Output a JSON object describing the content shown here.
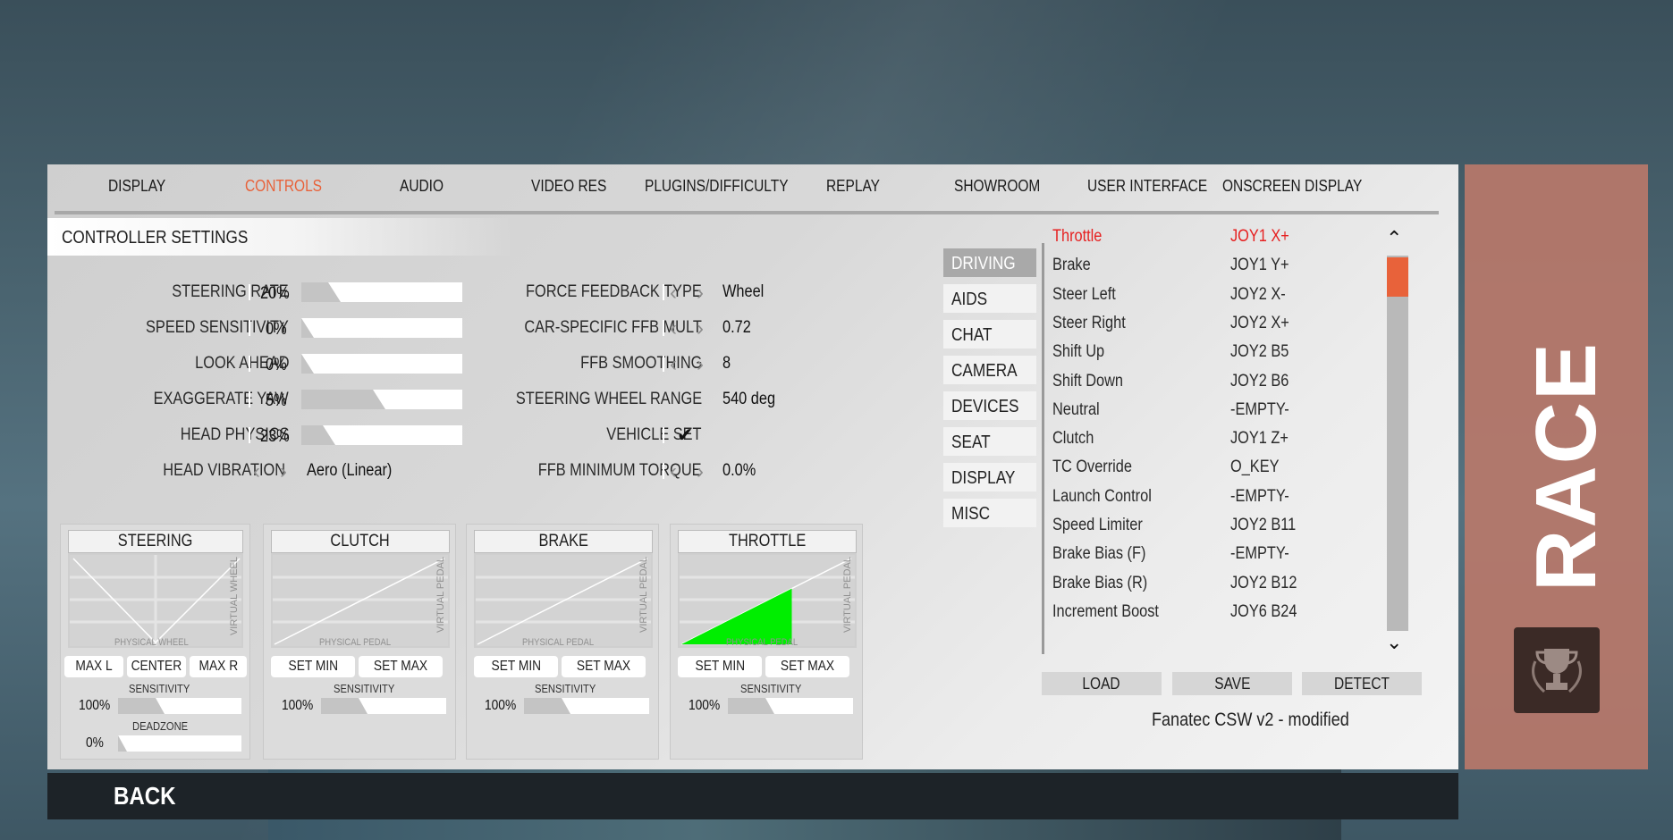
{
  "nav": {
    "tabs": [
      {
        "label": "DISPLAY"
      },
      {
        "label": "CONTROLS",
        "active": true
      },
      {
        "label": "AUDIO"
      },
      {
        "label": "VIDEO RES"
      },
      {
        "label": "PLUGINS/DIFFICULTY"
      },
      {
        "label": "REPLAY"
      },
      {
        "label": "SHOWROOM"
      },
      {
        "label": "USER INTERFACE"
      },
      {
        "label": "ONSCREEN DISPLAY"
      }
    ],
    "active_color": "#e8623a"
  },
  "section_title": "CONTROLLER SETTINGS",
  "left_settings": [
    {
      "label": "STEERING RATE",
      "value": "20%",
      "level": 0.2
    },
    {
      "label": "SPEED SENSITIVITY",
      "value": "0%",
      "level": 0.0
    },
    {
      "label": "LOOK AHEAD",
      "value": "0%",
      "level": 0.0
    },
    {
      "label": "EXAGGERATE YAW",
      "value": "5%",
      "level": 0.45
    },
    {
      "label": "HEAD PHYSICS",
      "value": "23%",
      "level": 0.2
    },
    {
      "label": "HEAD VIBRATION",
      "value": "Aero (Linear)"
    }
  ],
  "right_settings": [
    {
      "label": "FORCE FEEDBACK TYPE",
      "value": "Wheel",
      "arrows": true
    },
    {
      "label": "CAR-SPECIFIC FFB MULT",
      "value": "0.72",
      "arrows": true
    },
    {
      "label": "FFB SMOOTHING",
      "value": "8",
      "arrows": true
    },
    {
      "label": "STEERING WHEEL RANGE",
      "value": "540 deg",
      "arrows": false
    },
    {
      "label": "VEHICLE SET",
      "value": "✔",
      "arrows": false
    },
    {
      "label": "FFB MINIMUM TORQUE",
      "value": "0.0%",
      "arrows": true
    }
  ],
  "graphs": {
    "steering": {
      "title": "STEERING",
      "x_label": "PHYSICAL WHEEL",
      "y_label": "VIRTUAL WHEEL",
      "buttons": [
        "MAX L",
        "CENTER",
        "MAX R"
      ],
      "sensitivity_label": "SENSITIVITY",
      "sensitivity_value": "100%",
      "sensitivity_level": 0.3,
      "deadzone_label": "DEADZONE",
      "deadzone_value": "0%",
      "deadzone_level": 0.0
    },
    "clutch": {
      "title": "CLUTCH",
      "x_label": "PHYSICAL PEDAL",
      "y_label": "VIRTUAL PEDAL",
      "buttons": [
        "SET MIN",
        "SET MAX"
      ],
      "sensitivity_label": "SENSITIVITY",
      "sensitivity_value": "100%",
      "sensitivity_level": 0.3
    },
    "brake": {
      "title": "BRAKE",
      "x_label": "PHYSICAL PEDAL",
      "y_label": "VIRTUAL PEDAL",
      "buttons": [
        "SET MIN",
        "SET MAX"
      ],
      "sensitivity_label": "SENSITIVITY",
      "sensitivity_value": "100%",
      "sensitivity_level": 0.3
    },
    "throttle": {
      "title": "THROTTLE",
      "x_label": "PHYSICAL PEDAL",
      "y_label": "VIRTUAL PEDAL",
      "buttons": [
        "SET MIN",
        "SET MAX"
      ],
      "sensitivity_label": "SENSITIVITY",
      "sensitivity_value": "100%",
      "sensitivity_level": 0.3,
      "input_level": 0.65,
      "fill_color": "#00ee00"
    }
  },
  "categories": [
    {
      "label": "DRIVING",
      "active": true
    },
    {
      "label": "AIDS"
    },
    {
      "label": "CHAT"
    },
    {
      "label": "CAMERA"
    },
    {
      "label": "DEVICES"
    },
    {
      "label": "SEAT"
    },
    {
      "label": "DISPLAY"
    },
    {
      "label": "MISC"
    }
  ],
  "bindings": [
    {
      "action": "Throttle",
      "key": "JOY1 X+",
      "highlight": true
    },
    {
      "action": "Brake",
      "key": "JOY1 Y+"
    },
    {
      "action": "Steer Left",
      "key": "JOY2 X-"
    },
    {
      "action": "Steer Right",
      "key": "JOY2 X+"
    },
    {
      "action": "Shift Up",
      "key": "JOY2 B5"
    },
    {
      "action": "Shift Down",
      "key": "JOY2 B6"
    },
    {
      "action": "Neutral",
      "key": "-EMPTY-"
    },
    {
      "action": "Clutch",
      "key": "JOY1 Z+"
    },
    {
      "action": "TC Override",
      "key": "O_KEY"
    },
    {
      "action": "Launch Control",
      "key": "-EMPTY-"
    },
    {
      "action": "Speed Limiter",
      "key": "JOY2 B11"
    },
    {
      "action": "Brake Bias (F)",
      "key": "-EMPTY-"
    },
    {
      "action": "Brake Bias (R)",
      "key": "JOY2 B12"
    },
    {
      "action": "Increment Boost",
      "key": "JOY6 B24"
    }
  ],
  "scroll": {
    "up": "⌃",
    "down": "⌄",
    "position": 0.0
  },
  "profile_buttons": [
    "LOAD",
    "SAVE",
    "DETECT"
  ],
  "profile_name": "Fanatec CSW v2 - modified",
  "back_label": "BACK",
  "race_label": "RACE",
  "race_icon": "trophy-icon"
}
